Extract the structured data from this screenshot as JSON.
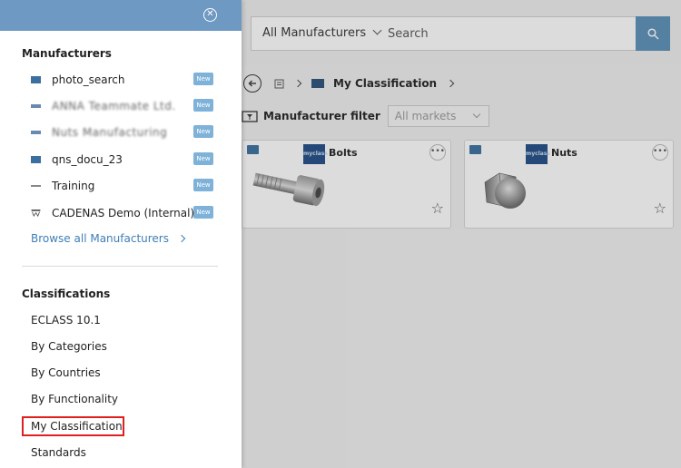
{
  "search": {
    "manufacturer_select": "All Manufacturers",
    "placeholder": "Search"
  },
  "breadcrumb": {
    "current": "My Classification"
  },
  "filter": {
    "label": "Manufacturer filter",
    "market_value": "All markets"
  },
  "cards": [
    {
      "name": "Bolts",
      "logo_text": "myclass"
    },
    {
      "name": "Nuts",
      "logo_text": "myclass"
    }
  ],
  "panel": {
    "close_icon": "close-icon",
    "manufacturers_title": "Manufacturers",
    "manufacturers": [
      {
        "label": "photo_search",
        "badge": "New",
        "icon_color": "#3a6fa0"
      },
      {
        "label": "ANNA Teammate Ltd.",
        "badge": "New",
        "icon_color": "#6a89b0",
        "blurred": true
      },
      {
        "label": "Nuts Manufacturing",
        "badge": "New",
        "icon_color": "#6a89b0",
        "blurred": true
      },
      {
        "label": "qns_docu_23",
        "badge": "New",
        "icon_color": "#3a6fa0"
      },
      {
        "label": "Training",
        "badge": "New",
        "icon_color": "#888888"
      },
      {
        "label": "CADENAS Demo (Internal)",
        "badge": "New",
        "icon_color": "#555555"
      }
    ],
    "browse_all": "Browse all Manufacturers",
    "classifications_title": "Classifications",
    "classifications": [
      {
        "label": "ECLASS 10.1"
      },
      {
        "label": "By Categories"
      },
      {
        "label": "By Countries"
      },
      {
        "label": "By Functionality"
      },
      {
        "label": "My Classification",
        "highlighted": true
      },
      {
        "label": "Standards"
      }
    ]
  },
  "colors": {
    "panel_header": "#6e99c2",
    "search_button": "#5a8fb8",
    "badge": "#7fb2d9",
    "link": "#3f7fb5",
    "highlight_border": "#e0201e"
  }
}
